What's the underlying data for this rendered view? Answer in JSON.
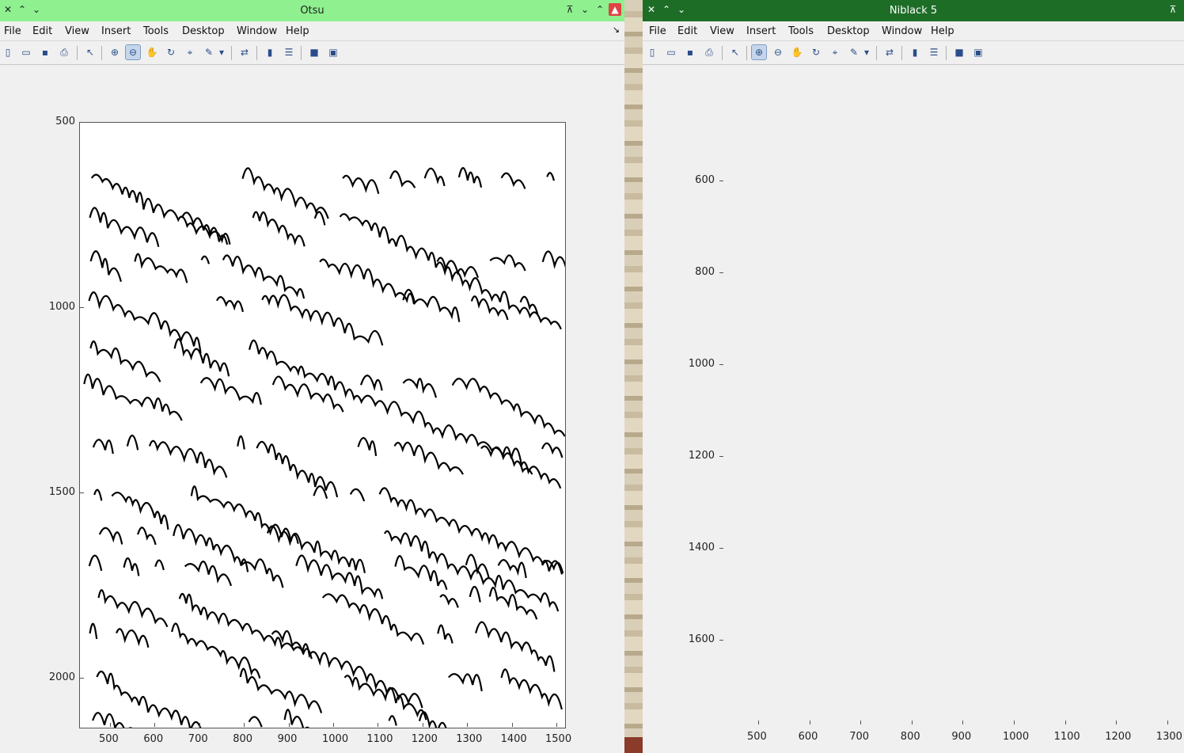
{
  "left_window": {
    "title": "Otsu",
    "menu": [
      "File",
      "Edit",
      "View",
      "Insert",
      "Tools",
      "Desktop",
      "Window",
      "Help"
    ],
    "x_ticks": [
      "500",
      "600",
      "700",
      "800",
      "900",
      "1000",
      "1100",
      "1200",
      "1300",
      "1400",
      "1500"
    ],
    "y_ticks": [
      "500",
      "1000",
      "1500",
      "2000"
    ]
  },
  "right_window": {
    "title": "Niblack 5",
    "menu": [
      "File",
      "Edit",
      "View",
      "Insert",
      "Tools",
      "Desktop",
      "Window",
      "Help"
    ],
    "x_ticks": [
      "500",
      "600",
      "700",
      "800",
      "900",
      "1000",
      "1100",
      "1200",
      "1300"
    ],
    "y_ticks": [
      "600",
      "800",
      "1000",
      "1200",
      "1400",
      "1600"
    ]
  },
  "toolbar_icons": [
    "new-file-icon",
    "open-folder-icon",
    "save-icon",
    "print-icon",
    "select-arrow-icon",
    "zoom-in-icon",
    "zoom-out-icon",
    "pan-hand-icon",
    "rotate-3d-icon",
    "data-cursor-icon",
    "brush-icon",
    "brush-dropdown-icon",
    "link-plot-icon",
    "colorbar-icon",
    "legend-icon",
    "hide-plot-tools-icon",
    "show-plot-tools-icon"
  ],
  "colors": {
    "left_titlebar": "#8ef08e",
    "right_titlebar": "#1d6d26",
    "ink": "#000000"
  }
}
